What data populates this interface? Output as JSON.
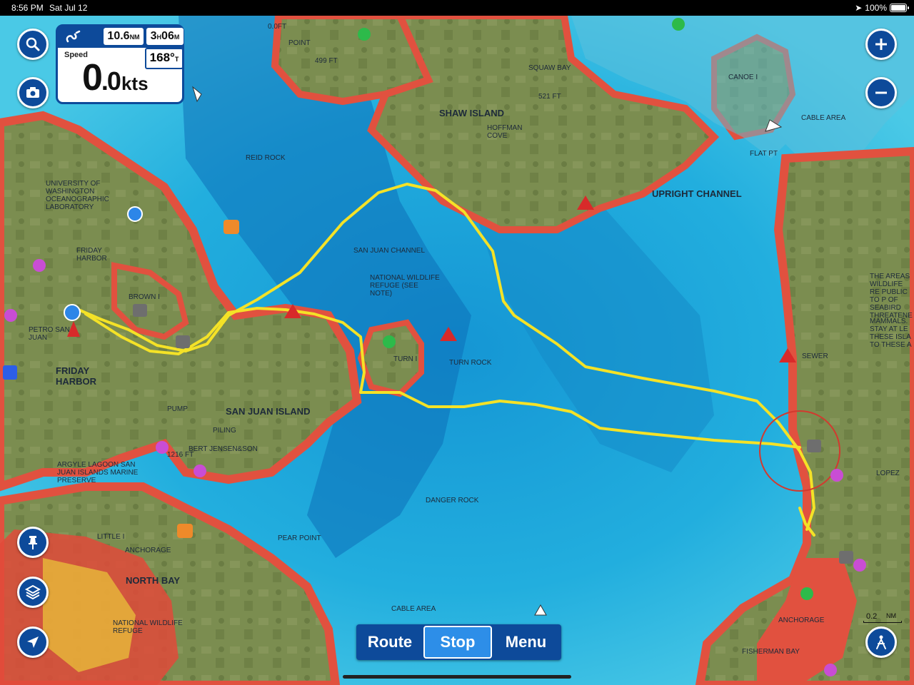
{
  "status": {
    "time": "8:56 PM",
    "date": "Sat Jul 12",
    "battery": "100%"
  },
  "info": {
    "distance": "10.6",
    "distance_unit": "NM",
    "time_h": "3",
    "time_h_unit": "H",
    "time_m": "06",
    "time_m_unit": "M",
    "speed_label": "Speed",
    "speed_int": "0",
    "speed_dec": ".0",
    "speed_unit": "kts",
    "heading": "168°",
    "heading_unit": "T"
  },
  "bottom_bar": {
    "route": "Route",
    "stop": "Stop",
    "menu": "Menu"
  },
  "scale": {
    "value": "0.2",
    "unit": "NM"
  },
  "map_labels": {
    "shaw_island": "SHAW ISLAND",
    "upright_channel": "UPRIGHT CHANNEL",
    "san_juan_island": "SAN JUAN ISLAND",
    "friday_harbor_town": "FRIDAY HARBOR",
    "friday_harbor": "FRIDAY HARBOR",
    "north_bay": "NORTH BAY",
    "san_juan_channel": "SAN JUAN CHANNEL",
    "wildlife_refuge": "NATIONAL WILDLIFE REFUGE (SEE NOTE)",
    "university": "UNIVERSITY OF WASHINGTON OCEANOGRAPHIC LABORATORY",
    "squaw_bay": "SQUAW BAY",
    "hoffman_cove": "HOFFMAN COVE",
    "canoe_i": "CANOE I",
    "cable_area": "CABLE AREA",
    "cable_area2": "CABLE AREA",
    "flat_pt": "FLAT PT",
    "turn_i": "TURN I",
    "turn_rock": "TURN ROCK",
    "brown_i": "BROWN I",
    "danger_rock": "DANGER ROCK",
    "pear_point": "PEAR POINT",
    "little_i": "LITTLE I",
    "anchorage": "ANCHORAGE",
    "anchorage2": "ANCHORAGE",
    "argyle": "ARGYLE LAGOON SAN JUAN ISLANDS MARINE PRESERVE",
    "bert": "BERT JENSEN&SON",
    "piling": "PILING",
    "pump": "PUMP",
    "sewer": "SEWER",
    "lopez": "LOPEZ",
    "fisherman_bay": "FISHERMAN BAY",
    "nat_wildlife_refuge": "NATIONAL WILDLIFE REFUGE",
    "petro": "PETRO SAN JUAN",
    "reid_rock": "REID ROCK",
    "point": "POINT",
    "areas_note": "THE AREAS WILDLIFE RE PUBLIC TO P OF SEABIRD THREATENE",
    "mammals_note": "MAMMALS. STAY AT LE THESE ISLA TO THESE A",
    "depth_521": "521 FT",
    "depth_499": "499 FT",
    "depth_1216": "1216 FT",
    "depth_0ft": "0.0FT"
  },
  "colors": {
    "button_blue": "#0d4a9a",
    "route_yellow": "#f4e227",
    "land": "#7c8e52",
    "deep_water": "#1ca0d8",
    "shallow": "#e14a3a"
  },
  "icons": {
    "search": "search-icon",
    "camera": "camera-icon",
    "zoom_in": "plus-icon",
    "zoom_out": "minus-icon",
    "waypoint": "pin-icon",
    "layers": "layers-icon",
    "locate": "navigation-arrow-icon",
    "follow": "person-icon"
  }
}
